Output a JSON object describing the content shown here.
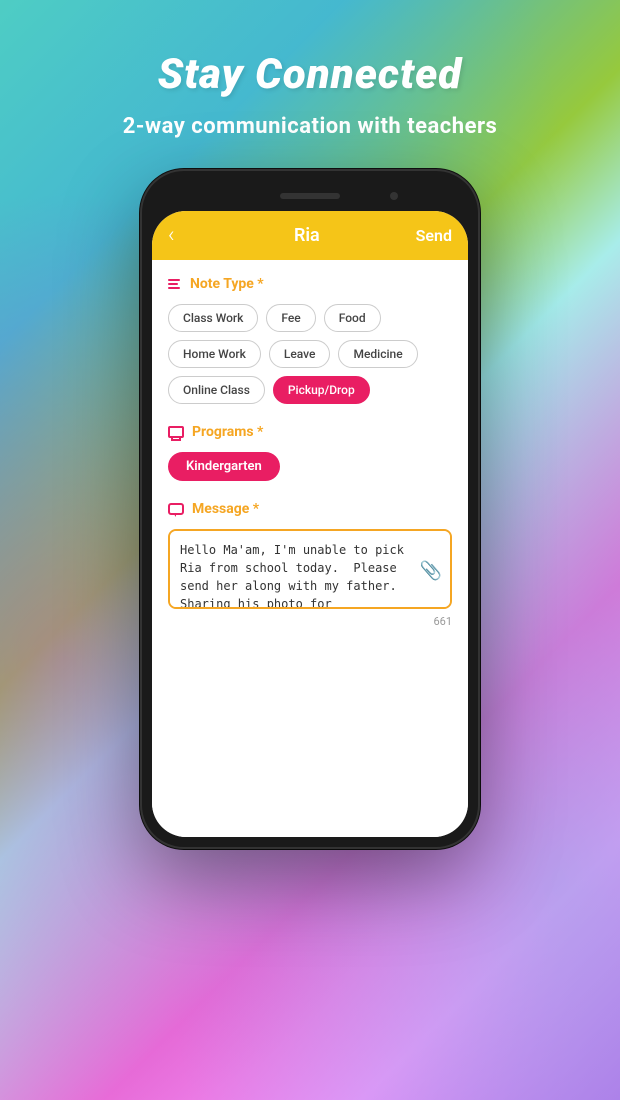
{
  "page": {
    "title": "Stay Connected",
    "subtitle": "2-way communication with teachers"
  },
  "app": {
    "header": {
      "back_label": "‹",
      "title": "Ria",
      "send_label": "Send"
    },
    "note_type": {
      "section_title": "Note Type *",
      "chips": [
        {
          "label": "Class Work",
          "selected": false
        },
        {
          "label": "Fee",
          "selected": false
        },
        {
          "label": "Food",
          "selected": false
        },
        {
          "label": "Home Work",
          "selected": false
        },
        {
          "label": "Leave",
          "selected": false
        },
        {
          "label": "Medicine",
          "selected": false
        },
        {
          "label": "Online Class",
          "selected": false
        },
        {
          "label": "Pickup/Drop",
          "selected": true
        }
      ]
    },
    "programs": {
      "section_title": "Programs *",
      "selected": "Kindergarten"
    },
    "message": {
      "section_title": "Message *",
      "value": "Hello Ma'am, I'm unable to pick Ria from school today.  Please send her along with my father. Sharing his photo for recognition. Thank you!",
      "char_count": "661"
    }
  }
}
